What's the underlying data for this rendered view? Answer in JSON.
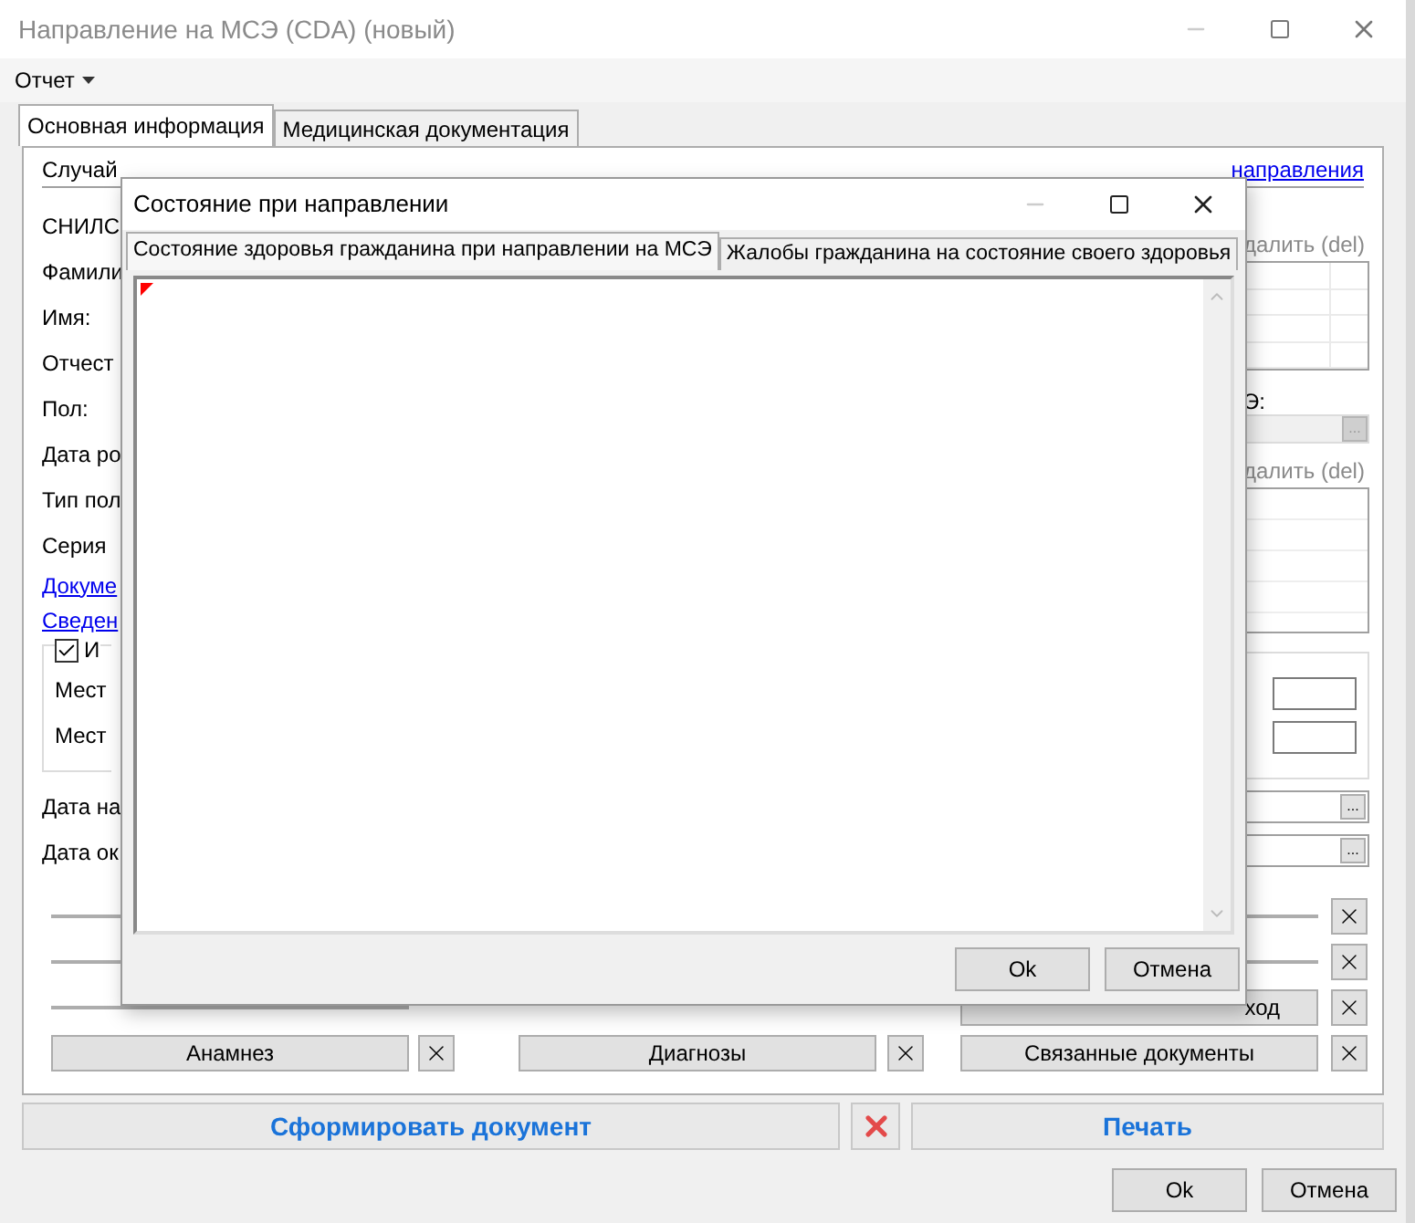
{
  "window": {
    "title": "Направление на МСЭ (CDA) (новый)"
  },
  "menu": [
    {
      "label": "Отчет"
    }
  ],
  "tabs": [
    {
      "label": "Основная информация",
      "selected": true
    },
    {
      "label": "Медицинская документация",
      "selected": false
    }
  ],
  "case_row": {
    "label": "Случай",
    "link": "направления"
  },
  "form_left": [
    {
      "kind": "label",
      "text": "СНИЛС"
    },
    {
      "kind": "label",
      "text": "Фамили"
    },
    {
      "kind": "label",
      "text": "Имя:"
    },
    {
      "kind": "label",
      "text": "Отчест"
    },
    {
      "kind": "label",
      "text": "Пол:"
    },
    {
      "kind": "label",
      "text": "Дата ро"
    },
    {
      "kind": "label",
      "text": "Тип пол"
    },
    {
      "kind": "label",
      "text": "Серия"
    },
    {
      "kind": "link",
      "text": "Докуме"
    },
    {
      "kind": "link",
      "text": "Сведен"
    },
    {
      "kind": "group",
      "text": "И",
      "checked": true,
      "children": [
        "Мест",
        "Мест"
      ]
    },
    {
      "kind": "label",
      "text": "Дата на"
    },
    {
      "kind": "label",
      "text": "Дата ок"
    }
  ],
  "form_right": {
    "delete_links": [
      "далить (del)",
      "далить (del)"
    ],
    "field_label": "Э:",
    "browse_buttons": [
      "...",
      "...",
      "..."
    ]
  },
  "action_rows": [
    {
      "kind": "partial"
    },
    {
      "kind": "partial"
    },
    {
      "kind": "partial",
      "right": "ход"
    },
    {
      "kind": "full",
      "left": "Анамнез",
      "middle": "Диагнозы",
      "right": "Связанные документы"
    }
  ],
  "footer": {
    "generate_button": "Сформировать документ",
    "print_button": "Печать",
    "buttons": [
      "Ok",
      "Отмена"
    ]
  },
  "dialog": {
    "title": "Состояние при направлении",
    "tabs": [
      {
        "label": "Состояние здоровья гражданина при направлении на МСЭ",
        "selected": true
      },
      {
        "label": "Жалобы гражданина на состояние своего здоровья",
        "selected": false
      }
    ],
    "buttons": [
      "Ok",
      "Отмена"
    ]
  }
}
